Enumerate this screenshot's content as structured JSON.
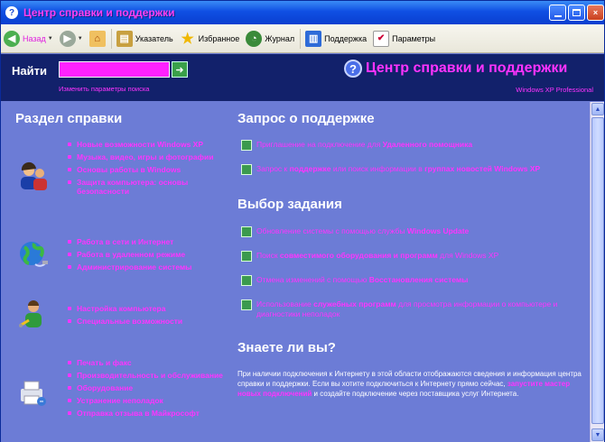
{
  "window": {
    "title": "Центр справки и поддержки"
  },
  "toolbar": {
    "back": "Назад",
    "index": "Указатель",
    "favorites": "Избранное",
    "history": "Журнал",
    "support": "Поддержка",
    "options": "Параметры"
  },
  "header": {
    "find": "Найти",
    "change_params": "Изменить параметры поиска",
    "brand": "Центр справки и поддержки",
    "edition": "Windows XP Professional"
  },
  "help_section": {
    "title": "Раздел справки",
    "groups": [
      {
        "icon": "users-icon",
        "items": [
          "Новые возможности Windows XP",
          "Музыка, видео, игры и фотографии",
          "Основы работы в Windows",
          "Защита компьютера: основы безопасности"
        ]
      },
      {
        "icon": "globe-network-icon",
        "items": [
          "Работа в сети и Интернет",
          "Работа в удаленном режиме",
          "Администрирование системы"
        ]
      },
      {
        "icon": "user-settings-icon",
        "items": [
          "Настройка компьютера",
          "Специальные возможности"
        ]
      },
      {
        "icon": "printer-hardware-icon",
        "items": [
          "Печать и факс",
          "Производительность и обслуживание",
          "Оборудование",
          "Устранение неполадок",
          "Отправка отзыва в Майкрософт"
        ]
      }
    ]
  },
  "support_request": {
    "title": "Запрос о поддержке",
    "items": [
      {
        "pre": "Приглашение на подключение для ",
        "bold": "Удаленного помощника",
        "post": ""
      },
      {
        "pre": "Запрос к ",
        "bold": "поддержке",
        "mid": " или поиск информации в ",
        "bold2": "группах новостей Windows XP",
        "post": ""
      }
    ]
  },
  "tasks": {
    "title": "Выбор задания",
    "items": [
      {
        "pre": "Обновление системы с помощью службы ",
        "bold": "Windows Update",
        "post": ""
      },
      {
        "pre": "Поиск ",
        "bold": "совместимого оборудования и программ",
        "post": " для Windows XP"
      },
      {
        "pre": "Отмена изменений с помощью ",
        "bold": "Восстановления системы",
        "post": ""
      },
      {
        "pre": "Использование ",
        "bold": "служебных программ",
        "post": " для просмотра информации о компьютере и диагностики неполадок"
      }
    ]
  },
  "did_you_know": {
    "title": "Знаете ли вы?",
    "text1": "При наличии подключения к Интернету в этой области отображаются сведения и информация центра справки и поддержки. Если вы хотите подключиться к Интернету прямо сейчас, ",
    "link": "запустите мастер новых подключений",
    "text2": " и создайте подключение через поставщика услуг Интернета."
  },
  "colors": {
    "accent": "#ff33ff",
    "background": "#6c7cd6",
    "header": "#12216b"
  }
}
